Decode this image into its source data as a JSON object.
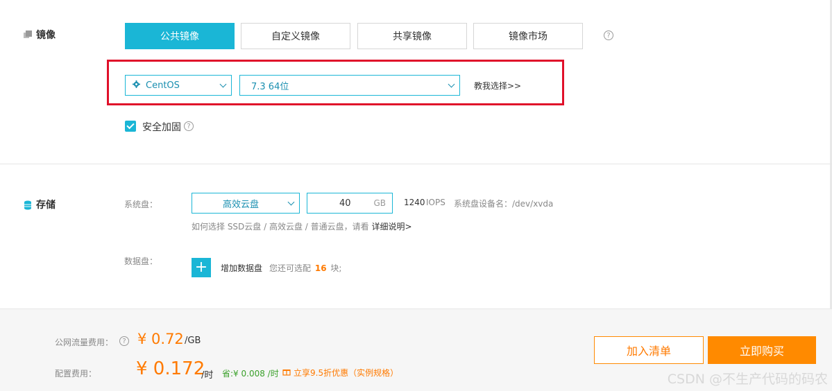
{
  "image_section": {
    "title": "镜像",
    "tabs": [
      {
        "label": "公共镜像",
        "active": true
      },
      {
        "label": "自定义镜像",
        "active": false
      },
      {
        "label": "共享镜像",
        "active": false
      },
      {
        "label": "镜像市场",
        "active": false
      }
    ],
    "os_select": "CentOS",
    "version_select": "7.3 64位",
    "help_choose_link": "教我选择>>",
    "security_label": "安全加固",
    "security_checked": true
  },
  "storage_section": {
    "title": "存储",
    "system_disk_label": "系统盘：",
    "disk_type_select": "高效云盘",
    "disk_size": "40",
    "disk_unit": "GB",
    "iops_value": "1240",
    "iops_unit": "IOPS",
    "device_name": "系统盘设备名：/dev/xvda",
    "hint_text": "如何选择 SSD云盘 / 高效云盘 / 普通云盘，请看",
    "hint_link": "详细说明>",
    "data_disk_label": "数据盘：",
    "add_data_disk": "增加数据盘",
    "remaining_prefix": "您还可选配",
    "remaining_count": "16",
    "remaining_suffix": "块;"
  },
  "footer": {
    "traffic_label": "公网流量费用：",
    "traffic_price": "¥ 0.72",
    "traffic_unit": "/GB",
    "config_label": "配置费用：",
    "config_price": "¥ 0.172",
    "config_unit": "/时",
    "savings": "省:¥ 0.008 /时",
    "discount": "立享9.5折优惠（实例规格）",
    "add_to_list": "加入清单",
    "buy_now": "立即购买"
  },
  "watermark": "CSDN @不生产代码的码农",
  "colors": {
    "accent": "#1ab6d6",
    "orange": "#ff8a00",
    "highlight": "#e0102a",
    "green": "#3aa02a"
  }
}
